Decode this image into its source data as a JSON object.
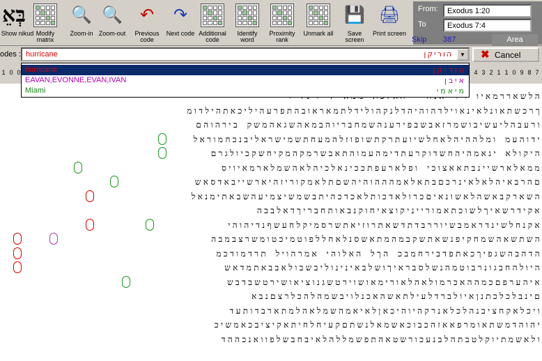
{
  "logo_text": "בְּאֵ",
  "toolbar": [
    {
      "label": "Show nikud",
      "icon": "show-nikud-icon"
    },
    {
      "label": "Modify matrix",
      "icon": "modify-matrix-icon"
    },
    {
      "label": "Zoom-in",
      "icon": "zoom-in-icon"
    },
    {
      "label": "Zoom-out",
      "icon": "zoom-out-icon"
    },
    {
      "label": "Previous code",
      "icon": "previous-code-icon"
    },
    {
      "label": "Next code",
      "icon": "next-code-icon"
    },
    {
      "label": "Additional code",
      "icon": "additional-code-icon"
    },
    {
      "label": "Identify word",
      "icon": "identify-word-icon"
    },
    {
      "label": "Proximity rank",
      "icon": "proximity-rank-icon"
    },
    {
      "label": "Unmark all",
      "icon": "unmark-all-icon"
    },
    {
      "label": "Save screen",
      "icon": "save-screen-icon"
    },
    {
      "label": "Print screen",
      "icon": "print-screen-icon"
    }
  ],
  "range": {
    "from_label": "From:",
    "from_value": "Exodus 1:20",
    "to_label": "To",
    "to_value": "Exodus 7:4"
  },
  "skip": {
    "label": "Skip",
    "value": "387"
  },
  "area_label": "Area",
  "codes": {
    "label": "odes :",
    "value": "hurricane",
    "hebrew": "הוריקן",
    "cancel_label": "Cancel"
  },
  "dropdown": [
    {
      "text": "hurricane",
      "hebrew": "הוריקן",
      "color": "#d00"
    },
    {
      "text": "EAVAN,EVONNE,EVAN,IVAN",
      "hebrew": "איבן",
      "color": "#b000b0"
    },
    {
      "text": "Miami",
      "hebrew": "מיאמי",
      "color": "#1a8a1a"
    }
  ],
  "col_numbers_left": [
    "1",
    "0",
    "0"
  ],
  "col_numbers_right": [
    "4",
    "3",
    "2",
    "1",
    "1",
    "0",
    "9",
    "8",
    "7"
  ],
  "matrix_rows": [
    "הלשאררמאיו ויר אנח  יהאלכת ממא לייוינל ו",
    "ךרכשתאונלאינאוילדהוהיהדלנקהולידלתמאראובהתפרעהיליכאתהילדומ",
    "ורעבהליעשיבושמרזאבשבפירענהשמחבריוהבמאהשגאהמשק בירהוהם",
    "ידוהעמ ומלההיהלאחלשיועתרקתשופוזלהמעחתשמישראליבנכחמוראל",
    "היקולא ינאמהיהחשדוקרעתדימהעמוהתאבשרמקהמקיחשקכיולגרם",
    "ממאלארשיינבתאאצוכי ופלארעפתככינאלכיהלאהשמלארמאיויס",
    "םהרבאיהלאלאינרכםבתאלאמהההוהיהשםתלאמקוריזהיארשייבאדסאש",
    "השארקבאשהלאשונאיםכרולאדכותלאכדכהיתבשמשיצמיעהשבאתימנאל",
    "אקידרשאיךלשוכתאמורייניקוצאיחוקנבאותחבריךדאלבבה",
    "אקנחלשינדראמבשיוררבדתדשאתרוזיאתשרסמיקלחעשףנדיהוהי",
    "השתשאהשמחקיפנשאתשקבמהמתאשסנלאחללפוטמיכטומשרצבמבה",
    "הדהבהשגפיךכאתפדבירחמבכ הךל האלוהי אמרהויל תרדמודכמ",
    "היולהחבגונרבוטמהנשלסבראיךושלבאינינוליבשבולאבבאתמדאש",
    "איהערפםכמההאכרמולאהלאורימאושוירטשגנוציאושירטשבדבש",
    "םינבלכלכתנןאיולברדלעילתאשהאכנלויבשמהלהכלרצםנבא",
    "ויכלאקחציבנהלכלאנרקהיוהיכאןלאיאמהשמלאהלמתארבדותעד",
    "יהוהדמשתאומרפאאזהכבוכאשמאלנשתםקעיחלחיתאקיציבכאמשיכ",
    "ולאשמתיוקלטבתהלבנעכורשטאהתפשמללהלאיבחבשלפוואנכההד"
  ],
  "highlights": [
    {
      "row": 3,
      "col": 31,
      "color": "g"
    },
    {
      "row": 4,
      "col": 31,
      "color": "g"
    },
    {
      "row": 5,
      "col": 38,
      "color": "g"
    },
    {
      "row": 6,
      "col": 35,
      "color": "g"
    },
    {
      "row": 7,
      "col": 37,
      "color": "r"
    },
    {
      "row": 8,
      "col": 45,
      "color": "g"
    },
    {
      "row": 9,
      "col": 32,
      "color": "g"
    },
    {
      "row": 9,
      "col": 37,
      "color": "r"
    },
    {
      "row": 10,
      "col": 40,
      "color": "m"
    },
    {
      "row": 10,
      "col": 43,
      "color": "r"
    },
    {
      "row": 11,
      "col": 43,
      "color": "r"
    },
    {
      "row": 12,
      "col": 43,
      "color": "r"
    },
    {
      "row": 13,
      "col": 34,
      "color": "g"
    }
  ]
}
